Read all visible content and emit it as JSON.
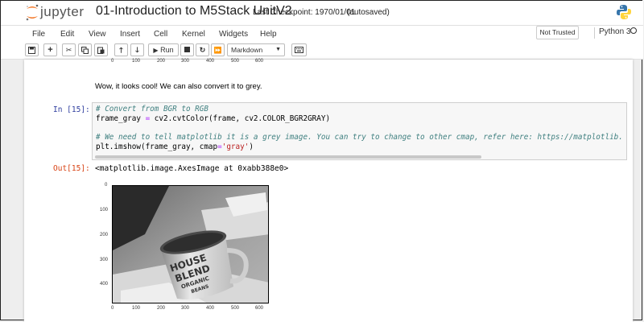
{
  "header": {
    "brand": "jupyter",
    "notebook_title": "01-Introduction to M5Stack UnitV2",
    "checkpoint": "Last Checkpoint: 1970/01/01",
    "autosave_status": "(autosaved)"
  },
  "menu": {
    "items": [
      "File",
      "Edit",
      "View",
      "Insert",
      "Cell",
      "Kernel",
      "Widgets",
      "Help"
    ],
    "trust_status": "Not Trusted",
    "kernel_name": "Python 3"
  },
  "toolbar": {
    "run_label": "Run",
    "cell_type": "Markdown"
  },
  "prev_axis": {
    "ticks": [
      "0",
      "100",
      "200",
      "300",
      "400",
      "500",
      "600"
    ]
  },
  "markdown_cell": {
    "text": "Wow, it looks cool! We can also convert it to grey."
  },
  "code_cell": {
    "prompt": "In [15]:",
    "line1": "# Convert from BGR to RGB",
    "line2_a": "frame_gray ",
    "line2_op": "=",
    "line2_b": " cv2.cvtColor(frame, cv2.COLOR_BGR2GRAY)",
    "line3": "# We need to tell matplotlib it is a grey image. You can try to change to other cmap, refer here: https://matplotlib.",
    "line4_a": "plt.imshow(frame_gray, cmap",
    "line4_op": "=",
    "line4_str": "'gray'",
    "line4_b": ")"
  },
  "output": {
    "prompt": "Out[15]:",
    "text": "<matplotlib.image.AxesImage at 0xabb388e0>"
  },
  "image_plot": {
    "y_ticks": [
      "0",
      "100",
      "200",
      "300",
      "400"
    ],
    "x_ticks": [
      "0",
      "100",
      "200",
      "300",
      "400",
      "500",
      "600"
    ],
    "mug_text": [
      "HOUSE",
      "BLEND",
      "ORGANIC",
      "BEANS"
    ]
  },
  "colors": {
    "in_prompt": "#303f9f",
    "out_prompt": "#d84315",
    "jupyter_orange": "#f37726"
  }
}
